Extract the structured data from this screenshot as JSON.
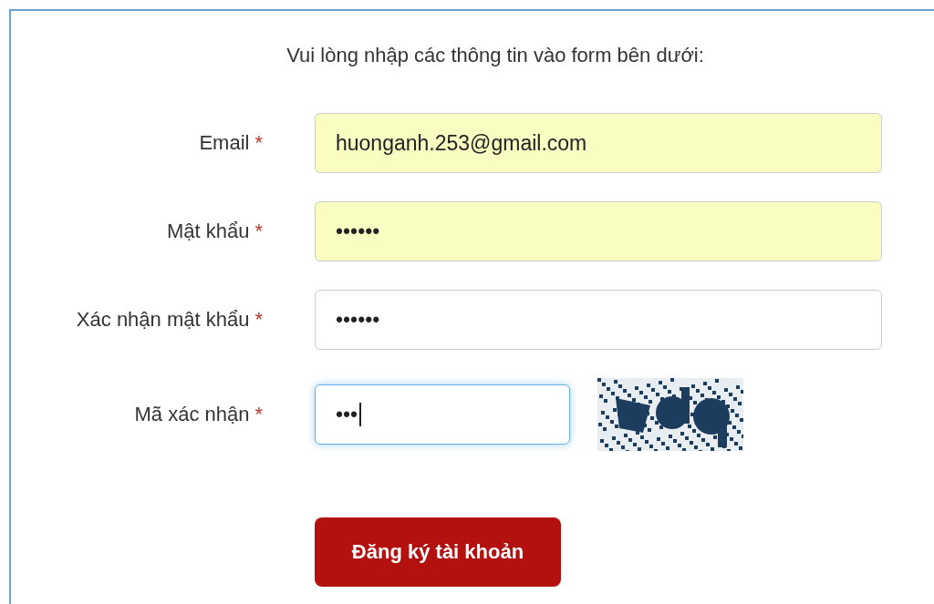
{
  "intro": "Vui lòng nhập các thông tin vào form bên dưới:",
  "fields": [
    {
      "label": "Email",
      "mark": "*",
      "value": "huonganh.253@gmail.com",
      "kind": "text",
      "autofilled": true,
      "focused": false
    },
    {
      "label": "Mật khẩu",
      "mark": "*",
      "value": "••••••",
      "kind": "text",
      "autofilled": true,
      "focused": false
    },
    {
      "label": "Xác nhận mật khẩu",
      "mark": "*",
      "value": "••••••",
      "kind": "text",
      "autofilled": false,
      "focused": false
    },
    {
      "label": "Mã xác nhận",
      "mark": "*",
      "value": "•••",
      "kind": "captcha",
      "autofilled": false,
      "focused": true
    }
  ],
  "submit": "Đăng ký tài khoản"
}
